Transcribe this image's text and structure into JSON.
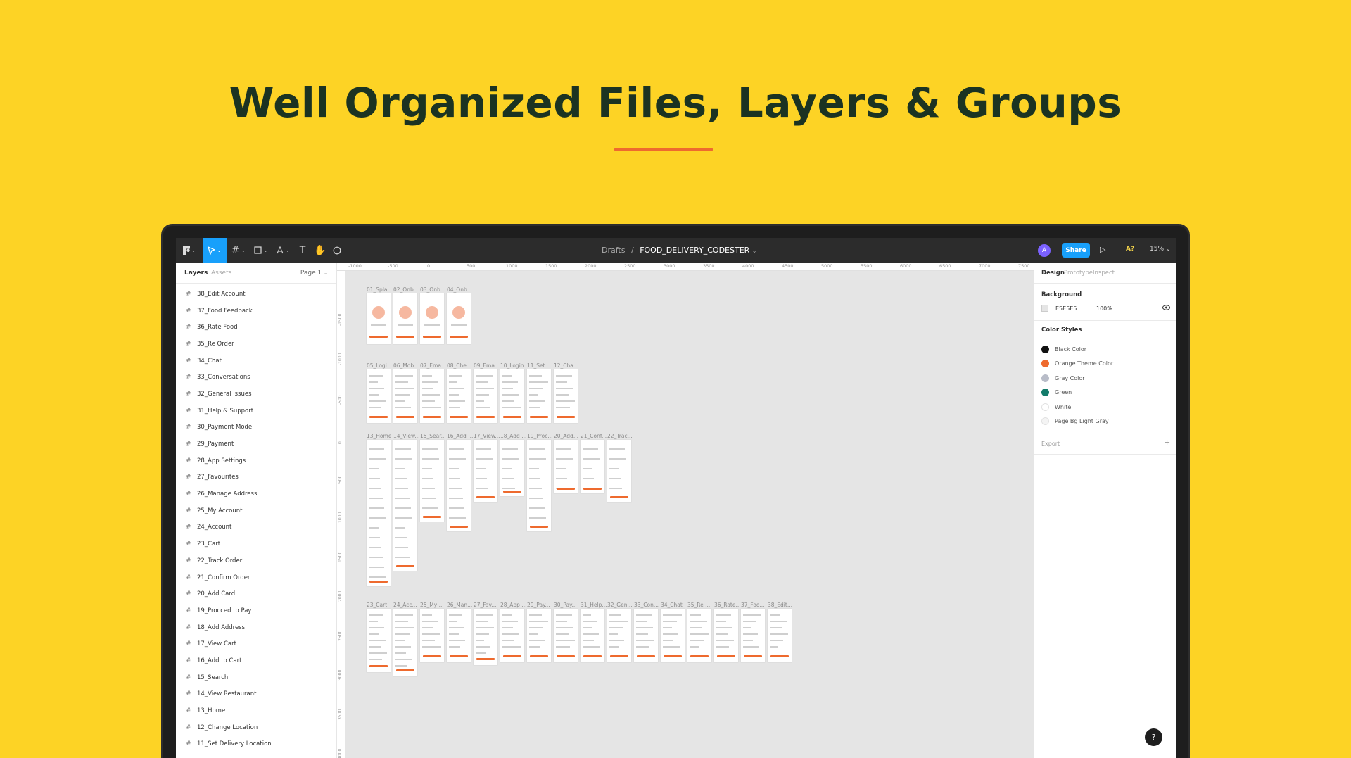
{
  "headline": "Well Organized Files, Layers & Groups",
  "colors": {
    "background": "#FDD325",
    "headline": "#1B3322",
    "accent": "#EE6A2E",
    "figma_blue": "#18A0FB"
  },
  "toolbar": {
    "tools": [
      "figma-menu-icon",
      "move-icon",
      "frame-icon",
      "shape-icon",
      "pen-icon",
      "text-icon",
      "hand-icon",
      "comment-icon"
    ],
    "breadcrumb_parent": "Drafts",
    "breadcrumb_sep": "/",
    "file_name": "FOOD_DELIVERY_CODESTER",
    "avatar": "A",
    "share_label": "Share",
    "ai_label": "A?",
    "zoom": "15%"
  },
  "left_panel": {
    "tab_layers": "Layers",
    "tab_assets": "Assets",
    "page": "Page 1",
    "layers": [
      "38_Edit Account",
      "37_Food Feedback",
      "36_Rate Food",
      "35_Re Order",
      "34_Chat",
      "33_Conversations",
      "32_General issues",
      "31_Help & Support",
      "30_Payment Mode",
      "29_Payment",
      "28_App Settings",
      "27_Favourites",
      "26_Manage Address",
      "25_My Account",
      "24_Account",
      "23_Cart",
      "22_Track Order",
      "21_Confirm Order",
      "20_Add Card",
      "19_Procced to Pay",
      "18_Add Address",
      "17_View Cart",
      "16_Add to Cart",
      "15_Search",
      "14_View Restaurant",
      "13_Home",
      "12_Change Location",
      "11_Set Delivery Location"
    ]
  },
  "rulers": {
    "top": [
      "-1000",
      "-500",
      "0",
      "500",
      "1000",
      "1500",
      "2000",
      "2500",
      "3000",
      "3500",
      "4000",
      "4500",
      "5000",
      "5500",
      "6000",
      "6500",
      "7000",
      "7500"
    ],
    "left": [
      "-1500",
      "-1000",
      "-500",
      "0",
      "500",
      "1000",
      "1500",
      "2000",
      "2500",
      "3000",
      "3500",
      "4000"
    ]
  },
  "frames": {
    "row1": [
      "01_Spla...",
      "02_Onb...",
      "03_Onb...",
      "04_Onb..."
    ],
    "row2": [
      "05_Logi...",
      "06_Mob...",
      "07_Ema...",
      "08_Che...",
      "09_Ema...",
      "10_Login",
      "11_Set ...",
      "12_Cha..."
    ],
    "row3": [
      "13_Home",
      "14_View...",
      "15_Sear...",
      "16_Add ...",
      "17_View...",
      "18_Add ...",
      "19_Proc...",
      "20_Add...",
      "21_Conf...",
      "22_Trac..."
    ],
    "row4": [
      "23_Cart",
      "24_Acc...",
      "25_My ...",
      "26_Man...",
      "27_Fav...",
      "28_App ...",
      "29_Pay...",
      "30_Pay...",
      "31_Help...",
      "32_Gen...",
      "33_Con...",
      "34_Chat",
      "35_Re ...",
      "36_Rate...",
      "37_Foo...",
      "38_Edit..."
    ]
  },
  "right_panel": {
    "tabs": [
      "Design",
      "Prototype",
      "Inspect"
    ],
    "background_title": "Background",
    "background_hex": "E5E5E5",
    "background_opacity": "100%",
    "color_styles_title": "Color Styles",
    "color_styles": [
      {
        "name": "Black Color",
        "color": "#111111"
      },
      {
        "name": "Orange Theme Color",
        "color": "#EE6A2E"
      },
      {
        "name": "Gray Color",
        "color": "#B8BCC8"
      },
      {
        "name": "Green",
        "color": "#137B6A"
      },
      {
        "name": "White",
        "color": "#FFFFFF"
      },
      {
        "name": "Page Bg Light Gray",
        "color": "#F4F4F4"
      }
    ],
    "export_label": "Export"
  },
  "help_label": "?"
}
